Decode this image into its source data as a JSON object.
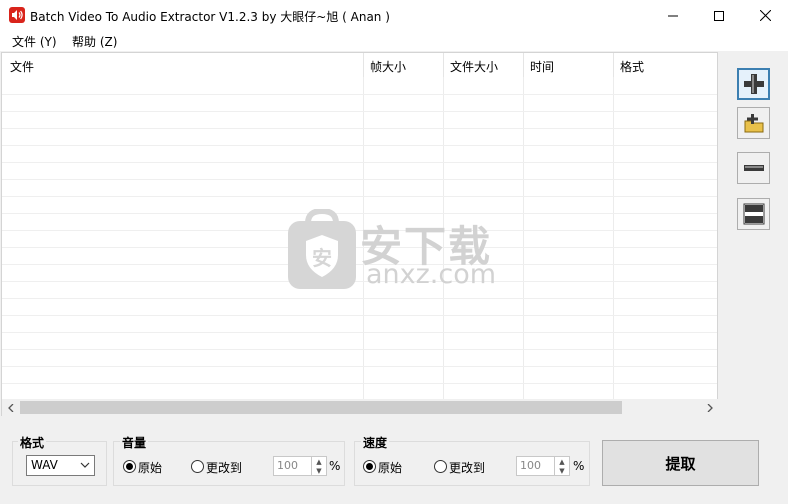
{
  "window": {
    "title": "Batch Video To Audio Extractor V1.2.3 by 大眼仔~旭 ( Anan )",
    "app_icon": "speaker-red-icon",
    "controls": [
      "minimize-icon",
      "maximize-icon",
      "close-icon"
    ]
  },
  "menu": {
    "items": [
      {
        "label": "文件 (Y)"
      },
      {
        "label": "帮助 (Z)"
      }
    ]
  },
  "file_list": {
    "columns": [
      {
        "label": "文件"
      },
      {
        "label": "帧大小"
      },
      {
        "label": "文件大小"
      },
      {
        "label": "时间"
      },
      {
        "label": "格式"
      }
    ],
    "rows": []
  },
  "watermark": {
    "text_cn": "安下载",
    "text_en": "anxz.com"
  },
  "toolbar": {
    "buttons": [
      {
        "icon": "plus-icon",
        "action": "add-files"
      },
      {
        "icon": "folder-add-icon",
        "action": "add-folder"
      },
      {
        "icon": "minus-icon",
        "action": "remove"
      },
      {
        "icon": "clear-list-icon",
        "action": "clear"
      }
    ]
  },
  "format": {
    "label": "格式",
    "selected": "WAV"
  },
  "volume": {
    "label": "音量",
    "option_original": "原始",
    "option_change": "更改到",
    "selected": "original",
    "value": "100",
    "unit": "%"
  },
  "speed": {
    "label": "速度",
    "option_original": "原始",
    "option_change": "更改到",
    "selected": "original",
    "value": "100",
    "unit": "%"
  },
  "extract": {
    "label": "提取"
  }
}
